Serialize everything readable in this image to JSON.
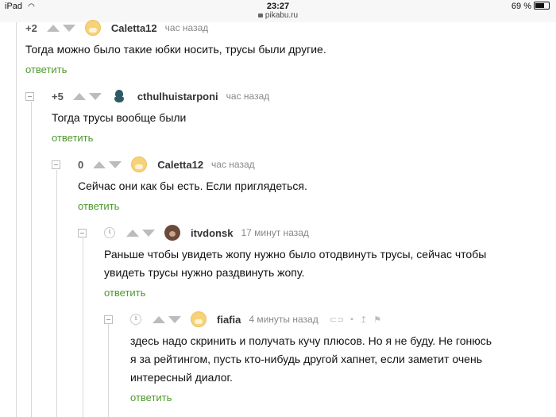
{
  "status_bar": {
    "device": "iPad",
    "wifi_icon": "wifi-icon",
    "time": "23:27",
    "url": "pikabu.ru",
    "battery": "69 %",
    "battery_level_percent": 69
  },
  "reply_label": "ответить",
  "comments": [
    {
      "rating": "+2",
      "author": "Caletta12",
      "time": "час назад",
      "avatar": "cat-avatar",
      "lines": [
        "Тогда можно было такие юбки носить, трусы были другие."
      ]
    },
    {
      "rating": "+5",
      "author": "cthulhuistarponi",
      "time": "час назад",
      "avatar": "cthulhu-avatar",
      "lines": [
        "Тогда трусы вообще были"
      ]
    },
    {
      "rating": "0",
      "author": "Caletta12",
      "time": "час назад",
      "avatar": "cat-avatar",
      "lines": [
        "Сейчас они как бы есть. Если приглядеться."
      ]
    },
    {
      "rating": "",
      "author": "itvdonsk",
      "time": "17 минут назад",
      "avatar": "bear-avatar",
      "lines": [
        "Раньше чтобы увидеть жопу нужно было отодвинуть трусы, сейчас чтобы",
        "увидеть трусы нужно раздвинуть жопу."
      ]
    },
    {
      "rating": "",
      "author": "fiafia",
      "time": "4 минуты назад",
      "avatar": "cat-avatar",
      "lines": [
        "здесь надо скринить и получать кучу плюсов. Но я не буду. Не гонюсь",
        "я за рейтингом, пусть кто-нибудь другой хапнет, если заметит очень",
        "интересный диалог."
      ]
    }
  ]
}
